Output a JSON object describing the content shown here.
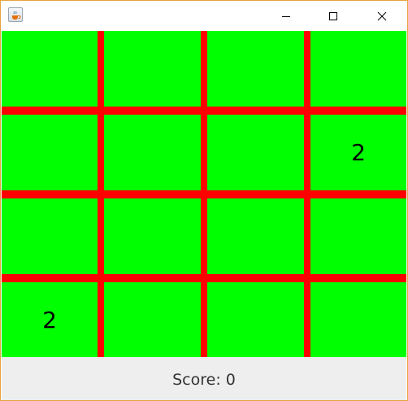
{
  "window": {
    "title": "",
    "icon": "java-coffee-cup-icon",
    "controls": [
      "minimize-icon",
      "maximize-icon",
      "close-icon"
    ]
  },
  "colors": {
    "cell": "#00ff00",
    "grid_line": "#ff0000",
    "status_bg": "#eeeeee",
    "window_border": "#e8a33d"
  },
  "board": {
    "rows": 4,
    "cols": 4,
    "cells": [
      [
        "",
        "",
        "",
        ""
      ],
      [
        "",
        "",
        "",
        "2"
      ],
      [
        "",
        "",
        "",
        ""
      ],
      [
        "2",
        "",
        "",
        ""
      ]
    ]
  },
  "status": {
    "score_text": "Score: 0"
  }
}
